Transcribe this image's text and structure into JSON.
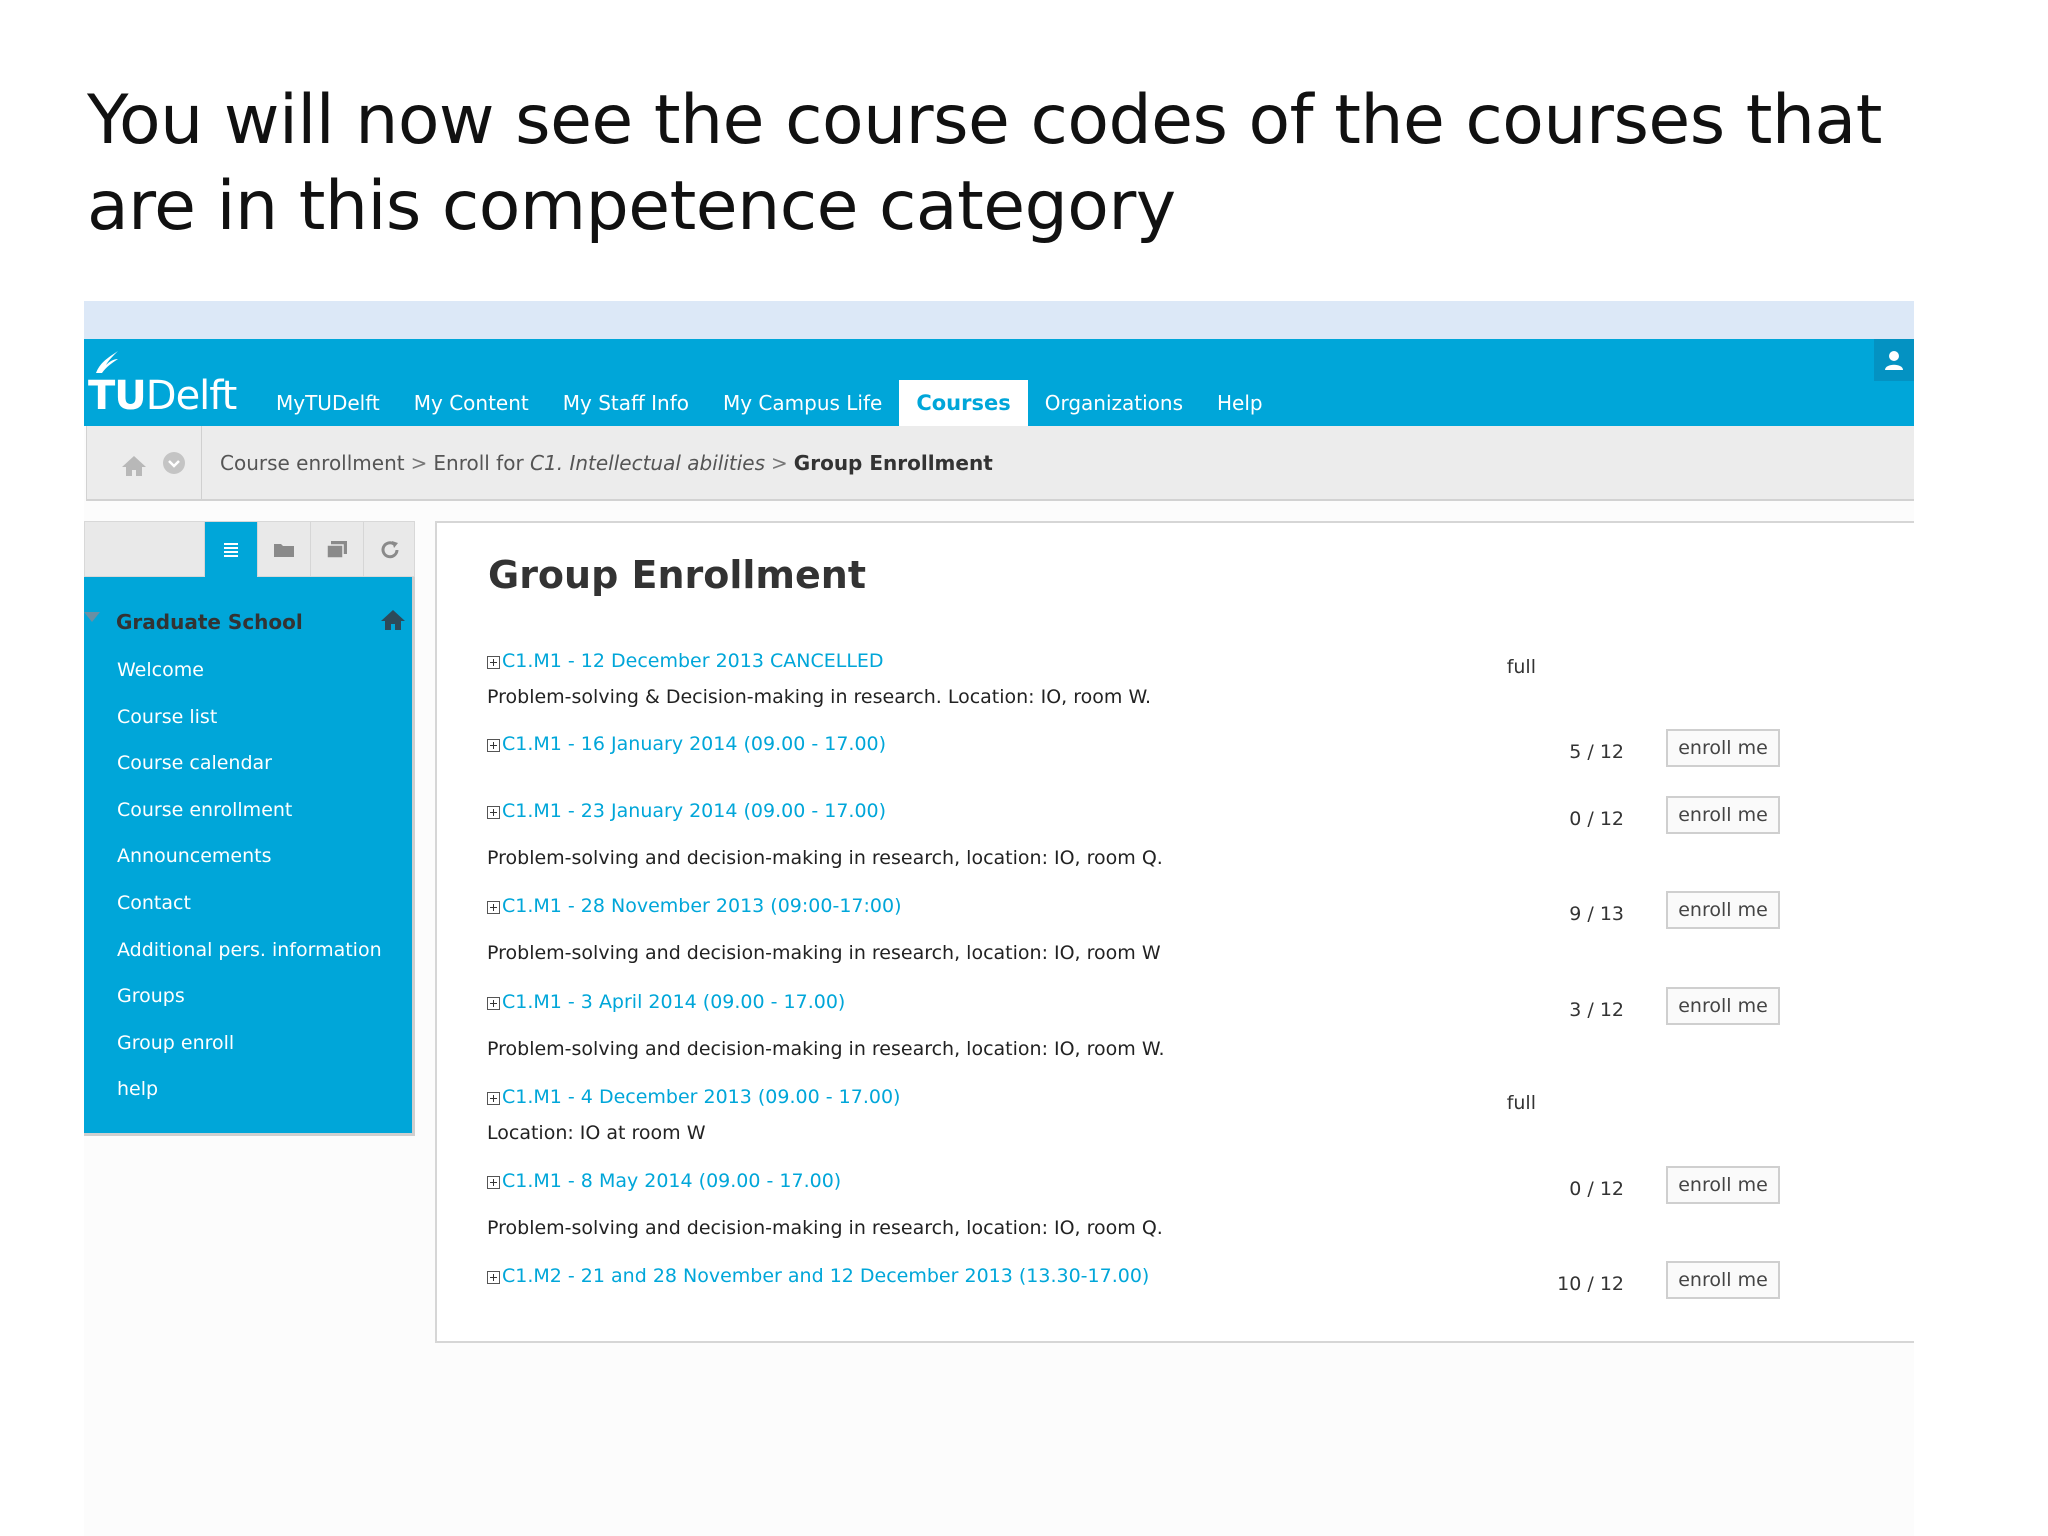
{
  "slide": {
    "title_line1": "You will now see the course codes of the courses that",
    "title_line2": "are in this competence category"
  },
  "app": {
    "logo": {
      "text_tu": "TU",
      "text_delft": "Delft"
    },
    "nav": [
      "MyTUDelft",
      "My Content",
      "My Staff Info",
      "My Campus Life",
      "Courses",
      "Organizations",
      "Help"
    ],
    "nav_active": "Courses",
    "breadcrumb": {
      "item1": "Course enrollment",
      "item2_prefix": "Enroll for ",
      "item2_italic": "C1. Intellectual abilities",
      "item3": "Group Enrollment",
      "separator": ">"
    },
    "sidebar": {
      "heading": "Graduate School",
      "items": [
        "Welcome",
        "Course list",
        "Course calendar",
        "Course enrollment",
        "Announcements",
        "Contact",
        "Additional pers. information",
        "Groups",
        "Group enroll",
        "help"
      ]
    },
    "main": {
      "title": "Group Enrollment",
      "enroll_label": "enroll me",
      "groups": [
        {
          "link": "C1.M1 - 12 December 2013 CANCELLED",
          "status": "full",
          "desc": "Problem-solving & Decision-making in research. Location: IO, room W."
        },
        {
          "link": "C1.M1 - 16 January 2014 (09.00 - 17.00)",
          "count": "5 / 12"
        },
        {
          "link": "C1.M1 - 23 January 2014 (09.00 - 17.00)",
          "count": "0 / 12",
          "desc": "Problem-solving and decision-making in research, location: IO, room Q."
        },
        {
          "link": "C1.M1 - 28 November 2013 (09:00-17:00)",
          "count": "9 / 13",
          "desc": "Problem-solving and decision-making in research, location: IO, room W"
        },
        {
          "link": "C1.M1 - 3 April 2014 (09.00 - 17.00)",
          "count": "3 / 12",
          "desc": "Problem-solving and decision-making in research, location: IO, room W."
        },
        {
          "link": "C1.M1 - 4 December 2013 (09.00 - 17.00)",
          "status": "full",
          "desc": "Location: IO at room W"
        },
        {
          "link": "C1.M1 - 8 May 2014 (09.00 - 17.00)",
          "count": "0 / 12",
          "desc": "Problem-solving and decision-making in research, location: IO, room Q."
        },
        {
          "link": "C1.M2 - 21 and 28 November and 12 December 2013 (13.30-17.00)",
          "count": "10 / 12"
        }
      ]
    }
  },
  "colors": {
    "brand": "#00a6d9",
    "strip": "#dce8f7"
  }
}
